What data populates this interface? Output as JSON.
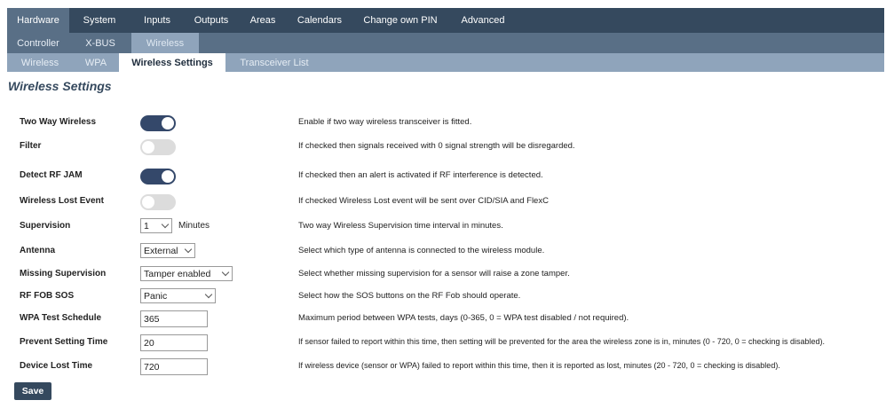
{
  "nav": {
    "primary": [
      "Hardware",
      "System",
      "Inputs",
      "Outputs",
      "Areas",
      "Calendars",
      "Change own PIN",
      "Advanced"
    ],
    "secondary": [
      "Controller",
      "X-BUS",
      "Wireless"
    ],
    "tertiary": [
      "Wireless",
      "WPA",
      "Wireless Settings",
      "Transceiver List"
    ]
  },
  "page_title": "Wireless Settings",
  "settings": {
    "two_way_wireless": {
      "label": "Two Way Wireless",
      "enabled": true,
      "desc": "Enable if two way wireless transceiver is fitted."
    },
    "filter": {
      "label": "Filter",
      "enabled": false,
      "desc": "If checked then signals received with 0 signal strength will be disregarded."
    },
    "detect_rf_jam": {
      "label": "Detect RF JAM",
      "enabled": true,
      "desc": "If checked then an alert is activated if RF interference is detected."
    },
    "wireless_lost_event": {
      "label": "Wireless Lost Event",
      "enabled": false,
      "desc": "If checked Wireless Lost event will be sent over CID/SIA and FlexC"
    },
    "supervision": {
      "label": "Supervision",
      "value": "1",
      "unit": "Minutes",
      "desc": "Two way Wireless Supervision time interval in minutes."
    },
    "antenna": {
      "label": "Antenna",
      "value": "External",
      "desc": "Select which type of antenna is connected to the wireless module."
    },
    "missing_supervision": {
      "label": "Missing Supervision",
      "value": "Tamper enabled",
      "desc": "Select whether missing supervision for a sensor will raise a zone tamper."
    },
    "rf_fob_sos": {
      "label": "RF FOB SOS",
      "value": "Panic",
      "desc": "Select how the SOS buttons on the RF Fob should operate."
    },
    "wpa_test_schedule": {
      "label": "WPA Test Schedule",
      "value": "365",
      "desc": "Maximum period between WPA tests, days (0-365, 0 = WPA test disabled / not required)."
    },
    "prevent_setting_time": {
      "label": "Prevent Setting Time",
      "value": "20",
      "desc": "If sensor failed to report within this time, then setting will be prevented for the area the wireless zone is in, minutes (0 - 720, 0 = checking is disabled)."
    },
    "device_lost_time": {
      "label": "Device Lost Time",
      "value": "720",
      "desc": "If wireless device (sensor or WPA) failed to report within this time, then it is reported as lost, minutes (20 - 720, 0 = checking is disabled)."
    }
  },
  "save_label": "Save",
  "colors": {
    "nav_dark": "#35495e",
    "nav_mid": "#596f86",
    "nav_light": "#8fa4bb",
    "toggle_on": "#34486a",
    "toggle_off": "#dcdcdc"
  }
}
